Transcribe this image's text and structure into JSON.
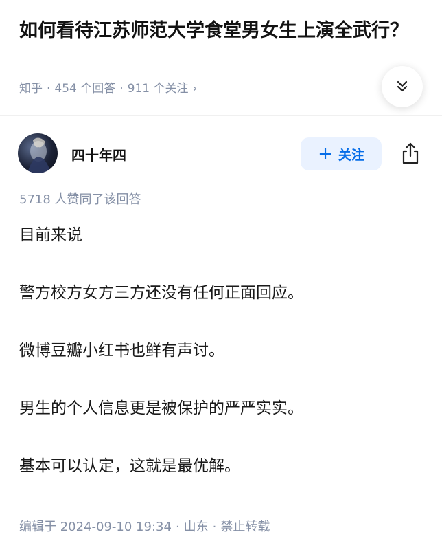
{
  "question": {
    "title": "如何看待江苏师范大学食堂男女生上演全武行？",
    "source": "知乎",
    "answer_count": "454 个回答",
    "follower_count": "911 个关注",
    "separator": "·",
    "chevron": "›"
  },
  "author": {
    "name": "四十年四",
    "follow_label": "关注",
    "follow_plus": "+"
  },
  "answer": {
    "likes_text": "5718 人赞同了该回答",
    "paragraphs": [
      "目前来说",
      "警方校方女方三方还没有任何正面回应。",
      "微博豆瓣小红书也鲜有声讨。",
      "男生的个人信息更是被保护的严严实实。",
      "基本可以认定，这就是最优解。"
    ],
    "edited": "编辑于 2024-09-10 19:34",
    "location": "山东",
    "copyright": "禁止转载"
  },
  "icons": {
    "collapse": "double-chevron-down-icon",
    "share": "share-icon",
    "avatar": "avatar"
  },
  "colors": {
    "accent": "#056de8",
    "follow_bg": "#eaf2ff",
    "meta_gray": "#8590a6"
  }
}
